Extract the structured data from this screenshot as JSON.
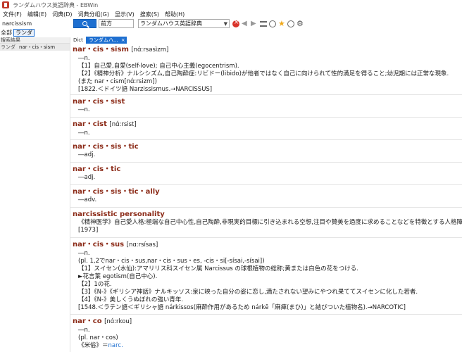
{
  "window": {
    "title": "ランダムハウス英語辞典 - EBWin"
  },
  "menu": [
    "文件(F)",
    "编辑(E)",
    "词典(D)",
    "词典分组(G)",
    "显示(V)",
    "搜索(S)",
    "帮助(H)"
  ],
  "toolbar": {
    "search_value": "narcissism",
    "search_mode": "前方",
    "dictionary": "ランダムハウス英語辞典"
  },
  "group": {
    "label": "全部",
    "button": "ランダ"
  },
  "left_pane": {
    "header": "搜索結果",
    "results": [
      {
        "dict": "ランダ",
        "word": "nar・cis・sism"
      }
    ]
  },
  "tabs": [
    {
      "label": "Dict"
    },
    {
      "label": "ランダムハ..."
    }
  ],
  "entries": [
    {
      "hw": "nar・cis・sism",
      "pron": "[nɑ́ːrsəsìzm]",
      "lines": [
        "―n.",
        "【1】自己愛,自愛(self-love); 自己中心主義(egocentrism).",
        "【2】《精神分析》ナルシシズム,自己陶酔症:リビドー(libido)が他者ではなく自己に向けられて性的満足を得ること;幼児期には正常な現象.",
        "(また nar・cism[nɑ́ːrsizm])",
        "[1822.＜ドイツ語 Narzissismus.→NARCISSUS]"
      ]
    },
    {
      "hw": "nar・cis・sist",
      "pron": "",
      "lines": [
        "―n."
      ]
    },
    {
      "hw": "nar・cist",
      "pron": "[nɑ́ːrsist]",
      "lines": [
        "―n."
      ]
    },
    {
      "hw": "nar・cis・sis・tic",
      "pron": "",
      "lines": [
        "―adj."
      ]
    },
    {
      "hw": "nar・cis・tic",
      "pron": "",
      "lines": [
        "―adj."
      ]
    },
    {
      "hw": "nar・cis・sis・tic・ally",
      "pron": "",
      "lines": [
        "―adv."
      ]
    },
    {
      "hw": "narcissistic personality",
      "pron": "",
      "lines": [
        "《精神医学》自己愛人格:極端な自己中心性,自己陶酔,非現実的目標に引き込まれる空想,注目や賛美を過度に求めることなどを特徴とする人格障害.",
        "[1973]"
      ]
    },
    {
      "hw": "nar・cis・sus",
      "pron": "[nɑːrsísəs]",
      "lines": [
        "―n.",
        "(pl. 1,2でnar・cis・sus,nar・cis・sus・es, -cis・si[-sísai,-sísai])",
        "【1】スイセン(水仙):アマリリス科スイセン属 Narcissus の球根植物の総称;黄または白色の花をつける.",
        "►花言葉 egotism(自己中心).",
        "【2】1の花.",
        "【3】《N-》《ギリシア神話》ナルキッソス:泉に映った自分の姿に恋し,満たされない望みにやつれ果ててスイセンに化した若者.",
        "【4】《N-》美しくうぬぼれの強い青年.",
        "[1548.＜ラテン語＜ギリシャ語 nárkissos(麻酔作用があるため nárkē「麻痺(まひ)」と結びついた植物名).→NARCOTIC]"
      ]
    },
    {
      "hw": "nar・co",
      "pron": "[nɑ́ːrkou]",
      "lines": [
        "―n.",
        "(pl. nar・cos)",
        "《米俗》＝"
      ],
      "xref": "narc."
    }
  ]
}
